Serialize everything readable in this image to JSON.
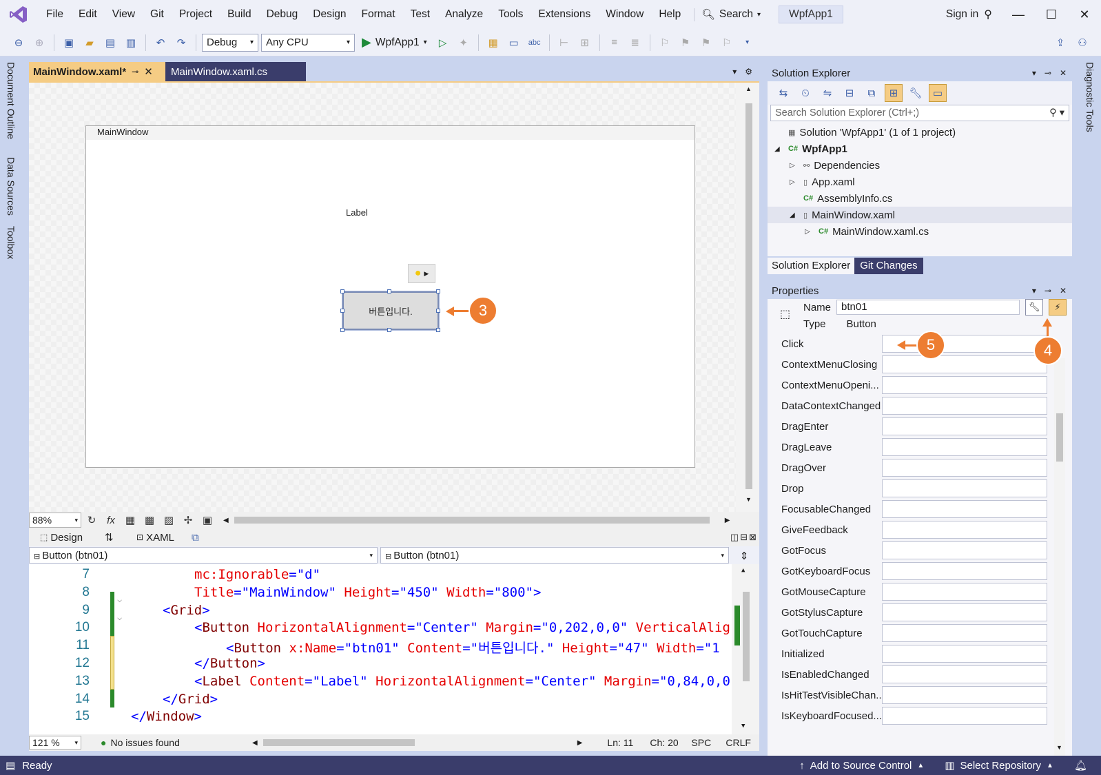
{
  "menu": {
    "items": [
      "File",
      "Edit",
      "View",
      "Git",
      "Project",
      "Build",
      "Debug",
      "Design",
      "Format",
      "Test",
      "Analyze",
      "Tools",
      "Extensions",
      "Window",
      "Help"
    ],
    "search_label": "Search",
    "app_name": "WpfApp1",
    "sign_in": "Sign in"
  },
  "toolbar": {
    "config": "Debug",
    "platform": "Any CPU",
    "run_target": "WpfApp1"
  },
  "left_rail": {
    "tabs": [
      "Document Outline",
      "Data Sources",
      "Toolbox"
    ]
  },
  "right_rail": {
    "tabs": [
      "Diagnostic Tools"
    ]
  },
  "doc_tabs": {
    "active": "MainWindow.xaml*",
    "other": "MainWindow.xaml.cs"
  },
  "designer": {
    "window_title": "MainWindow",
    "label_text": "Label",
    "button_text": "버튼입니다.",
    "zoom": "88%"
  },
  "view_tabs": {
    "design": "Design",
    "swap": "⇅",
    "xaml": "XAML"
  },
  "code_combos": {
    "left": "Button (btn01)",
    "right": "Button (btn01)"
  },
  "code": {
    "lines": [
      {
        "n": "7",
        "parts": [
          [
            "attr",
            "mc:Ignorable"
          ],
          [
            "punc",
            "="
          ],
          [
            "val",
            "\"d\""
          ]
        ],
        "indent": 2
      },
      {
        "n": "8",
        "parts": [
          [
            "attr",
            "Title"
          ],
          [
            "punc",
            "="
          ],
          [
            "val",
            "\"MainWindow\" "
          ],
          [
            "attr",
            "Height"
          ],
          [
            "punc",
            "="
          ],
          [
            "val",
            "\"450\" "
          ],
          [
            "attr",
            "Width"
          ],
          [
            "punc",
            "="
          ],
          [
            "val",
            "\"800\""
          ],
          [
            "punc",
            ">"
          ]
        ],
        "indent": 2
      },
      {
        "n": "9",
        "parts": [
          [
            "punc",
            "<"
          ],
          [
            "tag",
            "Grid"
          ],
          [
            "punc",
            ">"
          ]
        ],
        "indent": 1
      },
      {
        "n": "10",
        "parts": [
          [
            "punc",
            "<"
          ],
          [
            "tag",
            "Button "
          ],
          [
            "attr",
            "HorizontalAlignment"
          ],
          [
            "punc",
            "="
          ],
          [
            "val",
            "\"Center\" "
          ],
          [
            "attr",
            "Margin"
          ],
          [
            "punc",
            "="
          ],
          [
            "val",
            "\"0,202,0,0\" "
          ],
          [
            "attr",
            "VerticalAlig"
          ]
        ],
        "indent": 2
      },
      {
        "n": "11",
        "parts": [
          [
            "punc",
            "<"
          ],
          [
            "tag",
            "Button "
          ],
          [
            "attr",
            "x:Name"
          ],
          [
            "punc",
            "="
          ],
          [
            "val",
            "\"btn01\" "
          ],
          [
            "attr",
            "Content"
          ],
          [
            "punc",
            "="
          ],
          [
            "val",
            "\"버튼입니다.\" "
          ],
          [
            "attr",
            "Height"
          ],
          [
            "punc",
            "="
          ],
          [
            "val",
            "\"47\" "
          ],
          [
            "attr",
            "Width"
          ],
          [
            "punc",
            "="
          ],
          [
            "val",
            "\"1"
          ]
        ],
        "indent": 3
      },
      {
        "n": "12",
        "parts": [
          [
            "punc",
            "</"
          ],
          [
            "tag",
            "Button"
          ],
          [
            "punc",
            ">"
          ]
        ],
        "indent": 2
      },
      {
        "n": "13",
        "parts": [
          [
            "punc",
            "<"
          ],
          [
            "tag",
            "Label "
          ],
          [
            "attr",
            "Content"
          ],
          [
            "punc",
            "="
          ],
          [
            "val",
            "\"Label\" "
          ],
          [
            "attr",
            "HorizontalAlignment"
          ],
          [
            "punc",
            "="
          ],
          [
            "val",
            "\"Center\" "
          ],
          [
            "attr",
            "Margin"
          ],
          [
            "punc",
            "="
          ],
          [
            "val",
            "\"0,84,0,0"
          ]
        ],
        "indent": 2
      },
      {
        "n": "14",
        "parts": [
          [
            "punc",
            "</"
          ],
          [
            "tag",
            "Grid"
          ],
          [
            "punc",
            ">"
          ]
        ],
        "indent": 1
      },
      {
        "n": "15",
        "parts": [
          [
            "punc",
            "</"
          ],
          [
            "tag",
            "Window"
          ],
          [
            "punc",
            ">"
          ]
        ],
        "indent": 0
      }
    ],
    "status": {
      "zoom": "121 %",
      "issues": "No issues found",
      "ln": "Ln: 11",
      "ch": "Ch: 20",
      "spc": "SPC",
      "eol": "CRLF"
    }
  },
  "solution_explorer": {
    "title": "Solution Explorer",
    "search_placeholder": "Search Solution Explorer (Ctrl+;)",
    "items": [
      {
        "label": "Solution 'WpfApp1' (1 of 1 project)",
        "icon": "solution-icon",
        "level": 0,
        "expander": ""
      },
      {
        "label": "WpfApp1",
        "icon": "csharp-project-icon",
        "level": 0,
        "expander": "◢",
        "bold": true
      },
      {
        "label": "Dependencies",
        "icon": "dependencies-icon",
        "level": 1,
        "expander": "▷"
      },
      {
        "label": "App.xaml",
        "icon": "xaml-file-icon",
        "level": 1,
        "expander": "▷"
      },
      {
        "label": "AssemblyInfo.cs",
        "icon": "csharp-file-icon",
        "level": 1,
        "expander": ""
      },
      {
        "label": "MainWindow.xaml",
        "icon": "xaml-file-icon",
        "level": 1,
        "expander": "◢",
        "selected": true
      },
      {
        "label": "MainWindow.xaml.cs",
        "icon": "csharp-file-icon",
        "level": 2,
        "expander": "▷"
      }
    ],
    "tabs": [
      "Solution Explorer",
      "Git Changes"
    ]
  },
  "properties": {
    "title": "Properties",
    "name_label": "Name",
    "name_value": "btn01",
    "type_label": "Type",
    "type_value": "Button",
    "events": [
      "Click",
      "ContextMenuClosing",
      "ContextMenuOpeni...",
      "DataContextChanged",
      "DragEnter",
      "DragLeave",
      "DragOver",
      "Drop",
      "FocusableChanged",
      "GiveFeedback",
      "GotFocus",
      "GotKeyboardFocus",
      "GotMouseCapture",
      "GotStylusCapture",
      "GotTouchCapture",
      "Initialized",
      "IsEnabledChanged",
      "IsHitTestVisibleChan...",
      "IsKeyboardFocused..."
    ]
  },
  "callouts": {
    "three": "3",
    "four": "4",
    "five": "5"
  },
  "statusbar": {
    "ready": "Ready",
    "source_control": "Add to Source Control",
    "repository": "Select Repository"
  },
  "colors": {
    "accent": "#3a3d6b",
    "callout": "#ed7d31",
    "active_tab": "#f5cc84"
  }
}
